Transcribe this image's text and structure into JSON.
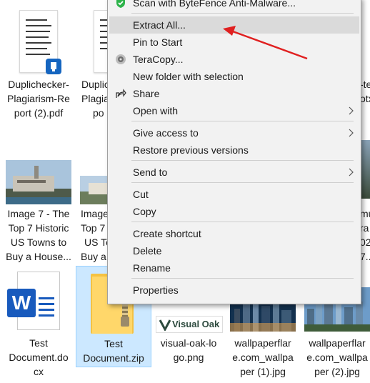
{
  "files": [
    {
      "name": "Duplichecker-Plagiarism-Report (2).pdf",
      "lines": [
        "Duplichecker-",
        "Plagiarism-Re",
        "port (2).pdf"
      ]
    },
    {
      "name": "Duplichecker partial",
      "lines": [
        "Duplic",
        "Plagia",
        "po"
      ]
    },
    {
      "name": "right cropped file 1",
      "lines": [
        "-te",
        "otx"
      ]
    },
    {
      "name": "Image 7 - The Top 7 Historic US Towns to Buy a House",
      "lines": [
        "Image 7 - The",
        "Top 7 Historic",
        "US Towns to",
        "Buy a House..."
      ]
    },
    {
      "name": "Image partial",
      "lines": [
        "Image",
        "Top 7",
        "US To",
        "Buy a"
      ]
    },
    {
      "name": "right cropped file 2",
      "lines": [
        "mu",
        "ra",
        "02",
        "7..."
      ]
    },
    {
      "name": "Test Document.docx",
      "lines": [
        "Test",
        "Document.do",
        "cx"
      ]
    },
    {
      "name": "Test Document.zip",
      "lines": [
        "Test",
        "Document.zip"
      ]
    },
    {
      "name": "visual-oak-logo.png",
      "lines": [
        "visual-oak-lo",
        "go.png"
      ]
    },
    {
      "name": "wallpaperflare.com_wallpaper (1).jpg",
      "lines": [
        "wallpaperflar",
        "e.com_wallpa",
        "per (1).jpg"
      ]
    },
    {
      "name": "wallpaperflare.com_wallpaper (2).jpg",
      "lines": [
        "wallpaperflar",
        "e.com_wallpa",
        "per (2).jpg"
      ]
    }
  ],
  "visual_oak_logo_text": "Visual Oak",
  "word_letter": "W",
  "context_menu": {
    "items": [
      {
        "label": "Scan with ByteFence Anti-Malware...",
        "icon": "bytefence-shield-icon"
      },
      {
        "label": "Extract All...",
        "highlighted": true
      },
      {
        "label": "Pin to Start"
      },
      {
        "label": "TeraCopy...",
        "icon": "teracopy-icon"
      },
      {
        "label": "New folder with selection"
      },
      {
        "label": "Share",
        "icon": "share-icon"
      },
      {
        "label": "Open with",
        "submenu": true
      },
      {
        "label": "Give access to",
        "submenu": true
      },
      {
        "label": "Restore previous versions"
      },
      {
        "label": "Send to",
        "submenu": true
      },
      {
        "label": "Cut"
      },
      {
        "label": "Copy"
      },
      {
        "label": "Create shortcut"
      },
      {
        "label": "Delete"
      },
      {
        "label": "Rename"
      },
      {
        "label": "Properties"
      }
    ]
  },
  "colors": {
    "selection": "#cce8ff",
    "menu_bg": "#f2f2f2",
    "menu_highlight": "#dadada",
    "annotation_arrow": "#e02020",
    "word_blue": "#185abd",
    "pdf_badge": "#1565c0",
    "zip_folder": "#f5c242"
  }
}
